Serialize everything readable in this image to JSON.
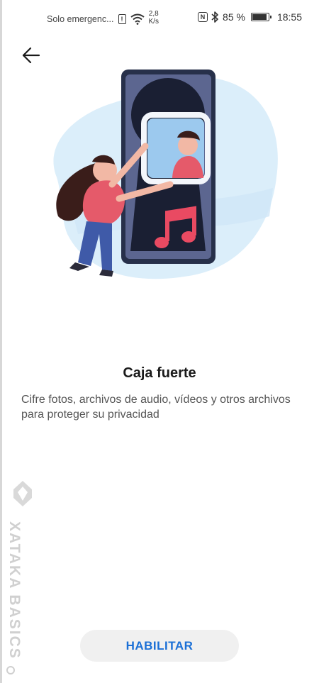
{
  "status_bar": {
    "carrier": "Solo emergenc...",
    "sim_icon": "sim-alert-icon",
    "wifi_icon": "wifi-icon",
    "net_speed_value": "2,8",
    "net_speed_unit": "K/s",
    "nfc_icon": "nfc-icon",
    "bluetooth_icon": "bluetooth-icon",
    "battery_percent": "85 %",
    "battery_level": 0.85,
    "time": "18:55"
  },
  "header": {
    "back_icon": "arrow-left-icon"
  },
  "illustration": {
    "name": "safe-illustration",
    "colors": {
      "blob": "#dbeefa",
      "phone_frame": "#27304a",
      "phone_screen": "#5c6690",
      "keyhole": "#1a1f33",
      "hair": "#3a1d1a",
      "shirt": "#e55a6a",
      "pants": "#3f5aa8",
      "music_note": "#e94a62"
    }
  },
  "content": {
    "title": "Caja fuerte",
    "description": "Cifre fotos, archivos de audio, vídeos y otros archivos para proteger su privacidad"
  },
  "watermark": {
    "text": "XATAKA BASICS"
  },
  "actions": {
    "enable_label": "HABILITAR"
  }
}
